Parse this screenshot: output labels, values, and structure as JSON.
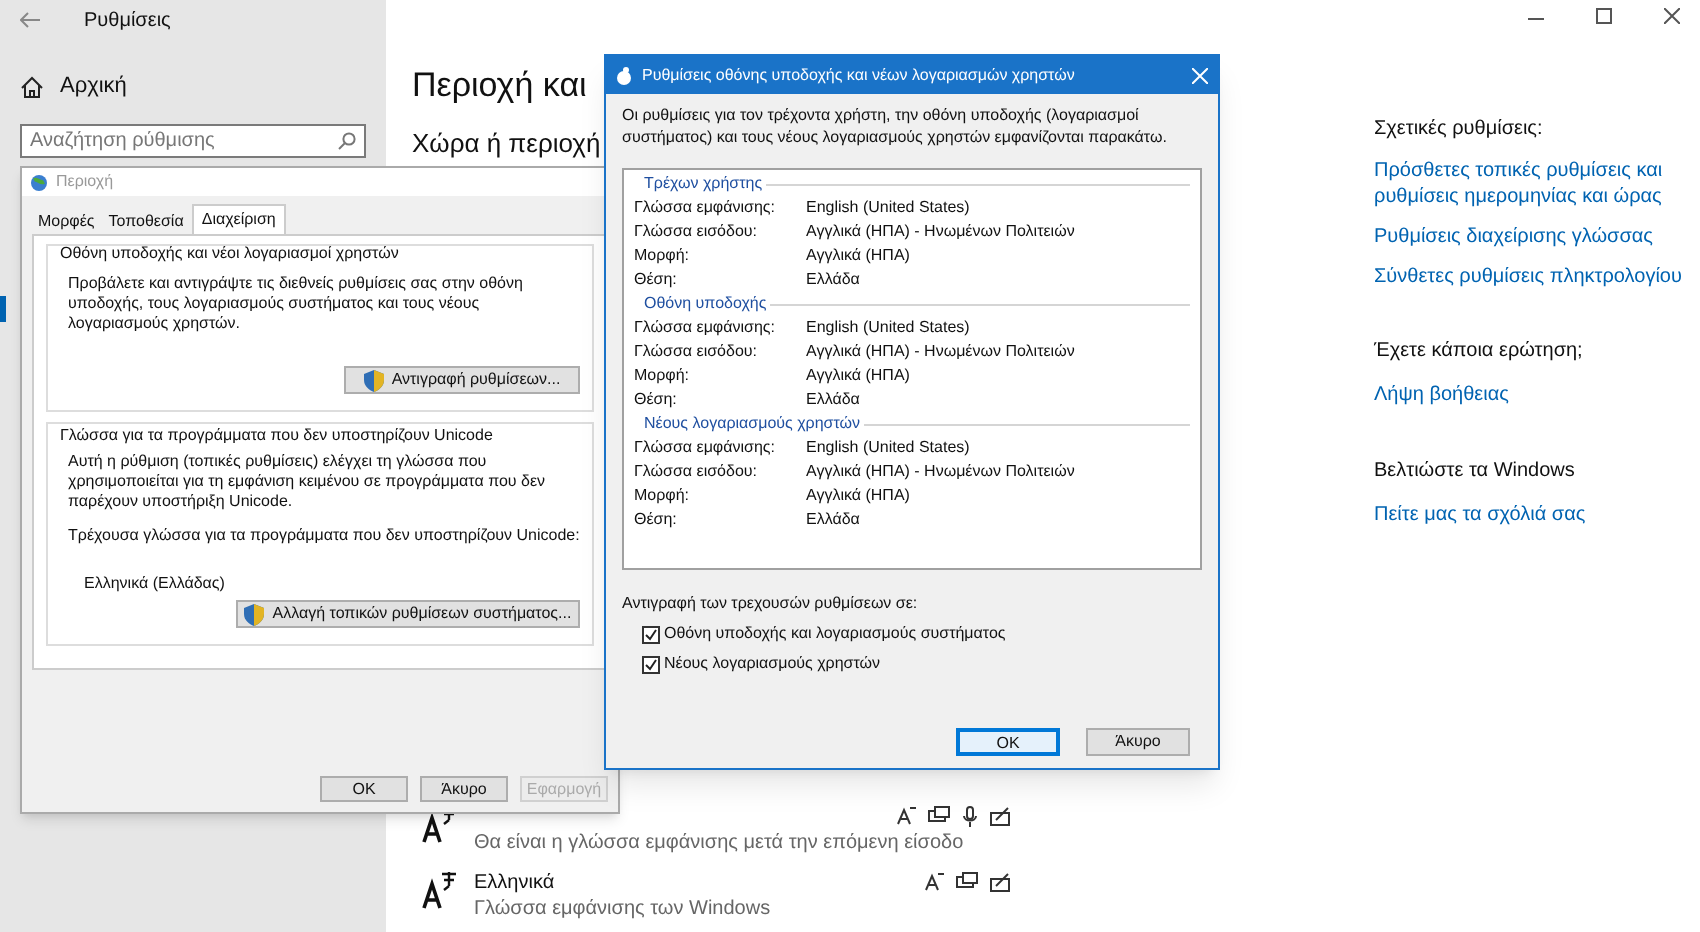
{
  "settings": {
    "title": "Ρυθμίσεις",
    "home": "Αρχική",
    "search": {
      "placeholder": "Αναζήτηση ρύθμισης"
    },
    "heading": "Περιοχή και",
    "subheading": "Χώρα ή περιοχή",
    "languages": [
      {
        "kind": "full",
        "description": "Θα είναι η γλώσσα εμφάνισης μετά την επόμενη είσοδο"
      },
      {
        "kind": "basic",
        "name": "Ελληνικά",
        "description": "Γλώσσα εμφάνισης των Windows"
      }
    ],
    "related": {
      "title": "Σχετικές ρυθμίσεις:",
      "links": [
        "Πρόσθετες τοπικές ρυθμίσεις και ρυθμίσεις ημερομηνίας και ώρας",
        "Ρυθμίσεις διαχείρισης γλώσσας",
        "Σύνθετες ρυθμίσεις πληκτρολογίου"
      ]
    },
    "help": {
      "title": "Έχετε κάποια ερώτηση;",
      "link": "Λήψη βοήθειας"
    },
    "feedback": {
      "title": "Βελτιώστε τα Windows",
      "link": "Πείτε μας τα σχόλιά σας"
    }
  },
  "region_dialog": {
    "title": "Περιοχή",
    "tabs": [
      {
        "label": "Μορφές",
        "selected": false
      },
      {
        "label": "Τοποθεσία",
        "selected": false
      },
      {
        "label": "Διαχείριση",
        "selected": true
      }
    ],
    "welcome_group": {
      "title": "Οθόνη υποδοχής και νέοι λογαριασμοί χρηστών",
      "text": "Προβάλετε και αντιγράψτε τις διεθνείς ρυθμίσεις σας στην οθόνη υποδοχής, τους λογαριασμούς συστήματος και τους νέους λογαριασμούς χρηστών.",
      "button": "Αντιγραφή ρυθμίσεων..."
    },
    "unicode_group": {
      "title": "Γλώσσα για τα προγράμματα που δεν υποστηρίζουν Unicode",
      "text": "Αυτή η ρύθμιση (τοπικές ρυθμίσεις) ελέγχει τη γλώσσα που χρησιμοποιείται για τη εμφάνιση κειμένου σε προγράμματα που δεν παρέχουν υποστήριξη Unicode.",
      "current_label": "Τρέχουσα γλώσσα για τα προγράμματα που δεν υποστηρίζουν Unicode:",
      "current_value": "Ελληνικά (Ελλάδας)",
      "button": "Αλλαγή τοπικών ρυθμίσεων συστήματος..."
    },
    "buttons": [
      {
        "label": "OK",
        "disabled": false
      },
      {
        "label": "Άκυρο",
        "disabled": false
      },
      {
        "label": "Εφαρμογή",
        "disabled": true
      }
    ]
  },
  "copy_dialog": {
    "title": "Ρυθμίσεις οθόνης υποδοχής και νέων λογαριασμών χρηστών",
    "intro": "Οι ρυθμίσεις για τον τρέχοντα χρήστη, την οθόνη υποδοχής (λογαριασμοί συστήματος) και τους νέους λογαριασμούς χρηστών εμφανίζονται παρακάτω.",
    "sections": [
      {
        "title": "Τρέχων χρήστης",
        "rows": [
          [
            "Γλώσσα εμφάνισης:",
            "English (United States)"
          ],
          [
            "Γλώσσα εισόδου:",
            "Αγγλικά (ΗΠΑ) - Ηνωμένων Πολιτειών"
          ],
          [
            "Μορφή:",
            "Αγγλικά (ΗΠΑ)"
          ],
          [
            "Θέση:",
            "Ελλάδα"
          ]
        ]
      },
      {
        "title": "Οθόνη υποδοχής",
        "rows": [
          [
            "Γλώσσα εμφάνισης:",
            "English (United States)"
          ],
          [
            "Γλώσσα εισόδου:",
            "Αγγλικά (ΗΠΑ) - Ηνωμένων Πολιτειών"
          ],
          [
            "Μορφή:",
            "Αγγλικά (ΗΠΑ)"
          ],
          [
            "Θέση:",
            "Ελλάδα"
          ]
        ]
      },
      {
        "title": "Νέους λογαριασμούς χρηστών",
        "rows": [
          [
            "Γλώσσα εμφάνισης:",
            "English (United States)"
          ],
          [
            "Γλώσσα εισόδου:",
            "Αγγλικά (ΗΠΑ) - Ηνωμένων Πολιτειών"
          ],
          [
            "Μορφή:",
            "Αγγλικά (ΗΠΑ)"
          ],
          [
            "Θέση:",
            "Ελλάδα"
          ]
        ]
      }
    ],
    "copy_label": "Αντιγραφή των τρεχουσών ρυθμίσεων σε:",
    "options": [
      {
        "label": "Οθόνη υποδοχής και λογαριασμούς συστήματος",
        "checked": true
      },
      {
        "label": "Νέους λογαριασμούς χρηστών",
        "checked": true
      }
    ],
    "buttons": [
      {
        "label": "OK",
        "selected": true
      },
      {
        "label": "Άκυρο",
        "selected": false
      }
    ]
  }
}
